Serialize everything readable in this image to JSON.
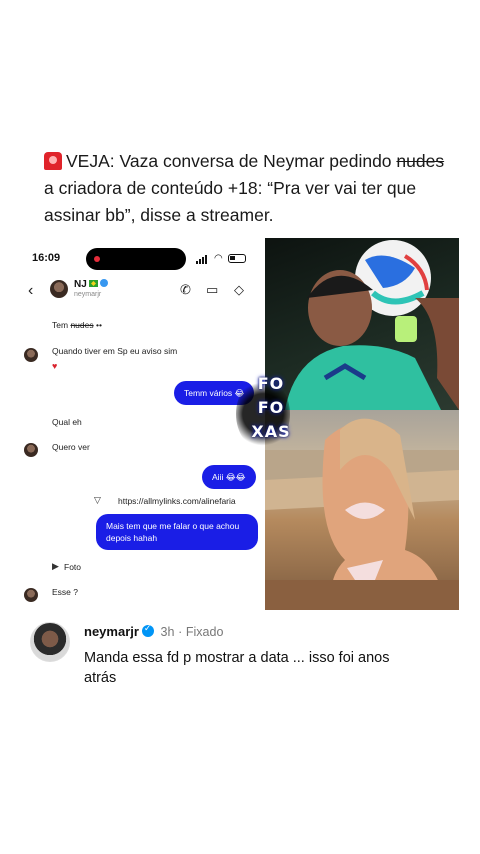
{
  "headline": {
    "part1": "VEJA: Vaza conversa de Neymar pedindo",
    "strike_word": "nudes",
    "part2": "a criadora de conteúdo +18: “Pra ver vai ter que assinar bb”, disse a streamer."
  },
  "phone": {
    "time": "16:09",
    "contact_name": "NJ",
    "contact_username": "neymarjr"
  },
  "messages": {
    "m1": "Tem",
    "m1_strike": "nudes",
    "m1_suffix": "••",
    "m2": "Quando tiver em Sp eu aviso sim",
    "m3": "Temm vários 😂",
    "m4": "Qual eh",
    "m5": "Quero ver",
    "m6": "Aiii 😂😂",
    "m7_link": "https://allmylinks.com/alinefaria",
    "m8": "Mais tem que me falar o que achou depois hahah",
    "m9": "Foto",
    "m10": "Esse ?"
  },
  "watermark": {
    "line1": "FO",
    "line2": "FO",
    "line3": "XAS"
  },
  "comment": {
    "username": "neymarjr",
    "time": "3h",
    "pinned": "Fixado",
    "text": "Manda essa fd p mostrar a data ... isso foi anos atrás"
  },
  "colors": {
    "bubble": "#1a1ee6",
    "verified": "#0095f6",
    "siren": "#e0232a"
  },
  "icons": [
    "siren-icon",
    "back-arrow-icon",
    "phone-icon",
    "video-icon",
    "tag-icon",
    "link-icon",
    "play-icon",
    "heart-icon",
    "verified-icon"
  ]
}
